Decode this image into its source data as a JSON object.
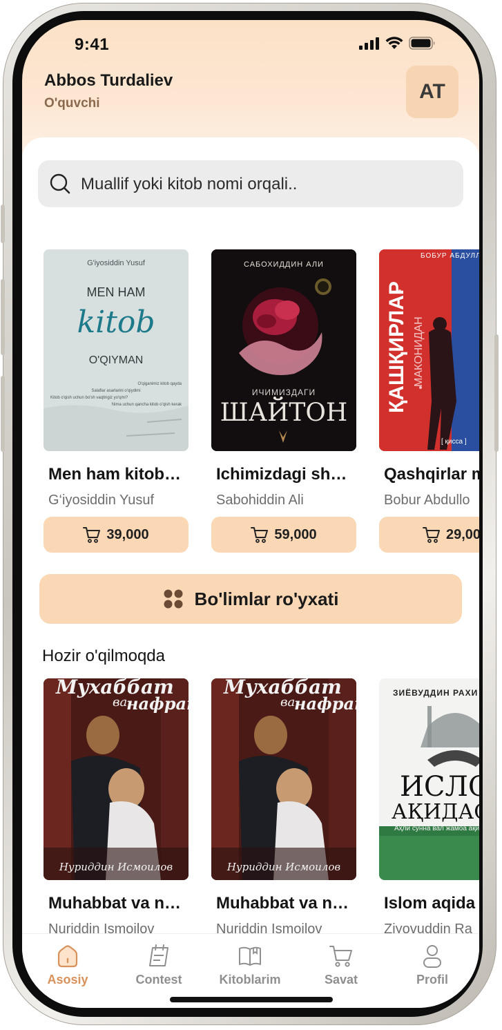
{
  "status_bar": {
    "time": "9:41"
  },
  "header": {
    "user_name": "Abbos Turdaliev",
    "user_role": "O'quvchi",
    "avatar_initials": "AT"
  },
  "search": {
    "placeholder": "Muallif yoki kitob nomi orqali.."
  },
  "featured_books": [
    {
      "title": "Men ham kitob…",
      "author": "G‘iyosiddin Yusuf",
      "price": "39,000",
      "cover": {
        "author": "G'iyosiddin Yusuf",
        "line1": "MEN HAM",
        "script": "kitob",
        "line2": "O'QIYMAN",
        "lines": [
          "O'qiganimiz kitob qayda",
          "Salaflar asarlarini o'qiydimi",
          "Kitob o'qish uchun bo'sh vaqtingiz yo'qmi?",
          "Nima uchun qancha kitob o'qish kerak"
        ]
      }
    },
    {
      "title": "Ichimizdagi sh…",
      "author": "Sabohiddin Ali",
      "price": "59,000",
      "cover": {
        "author": "САБОХИДДИН АЛИ",
        "small": "ИЧИМИЗДАГИ",
        "big": "ШАЙТОН"
      }
    },
    {
      "title": "Qashqirlar m",
      "author": "Bobur Abdullo",
      "price": "29,00",
      "cover": {
        "author": "БОБУР АБДУЛЛОХ",
        "vertical": "ҚАШҚИРЛАР",
        "sub": "МАКОНИДАН",
        "bottom": "[ қисса ]"
      }
    }
  ],
  "categories_button": {
    "label": "Bo'limlar ro'yxati"
  },
  "now_reading": {
    "title": "Hozir o'qilmoqda",
    "books": [
      {
        "title": "Muhabbat va n…",
        "author": "Nuriddin Ismoilov",
        "cover": {
          "title_top": "Мухаббат",
          "title_mid": "ва",
          "title_bottom": "нафрат",
          "author": "Нуриддин Исмоилов"
        }
      },
      {
        "title": "Muhabbat va n…",
        "author": "Nuriddin Ismoilov",
        "cover": {
          "title_top": "Мухаббат",
          "title_mid": "ва",
          "title_bottom": "нафрат",
          "author": "Нуриддин Исмоилов"
        }
      },
      {
        "title": "Islom aqida",
        "author": "Ziyovuddin Ra",
        "cover": {
          "author": "ЗИЁВУДДИН РАХИ",
          "big1": "ИСЛО",
          "big2": "АҚИДАС",
          "sub": "Аҳли сунна вал жамоа ақи"
        }
      }
    ]
  },
  "tabbar": {
    "items": [
      {
        "label": "Asosiy",
        "icon": "home-icon",
        "active": true
      },
      {
        "label": "Contest",
        "icon": "contest-icon",
        "active": false
      },
      {
        "label": "Kitoblarim",
        "icon": "book-icon",
        "active": false
      },
      {
        "label": "Savat",
        "icon": "cart-icon",
        "active": false
      },
      {
        "label": "Profil",
        "icon": "profile-icon",
        "active": false
      }
    ]
  },
  "colors": {
    "accent": "#fbd8b5",
    "active_tab": "#d8915a",
    "header_bg": "#fbe1c6"
  }
}
